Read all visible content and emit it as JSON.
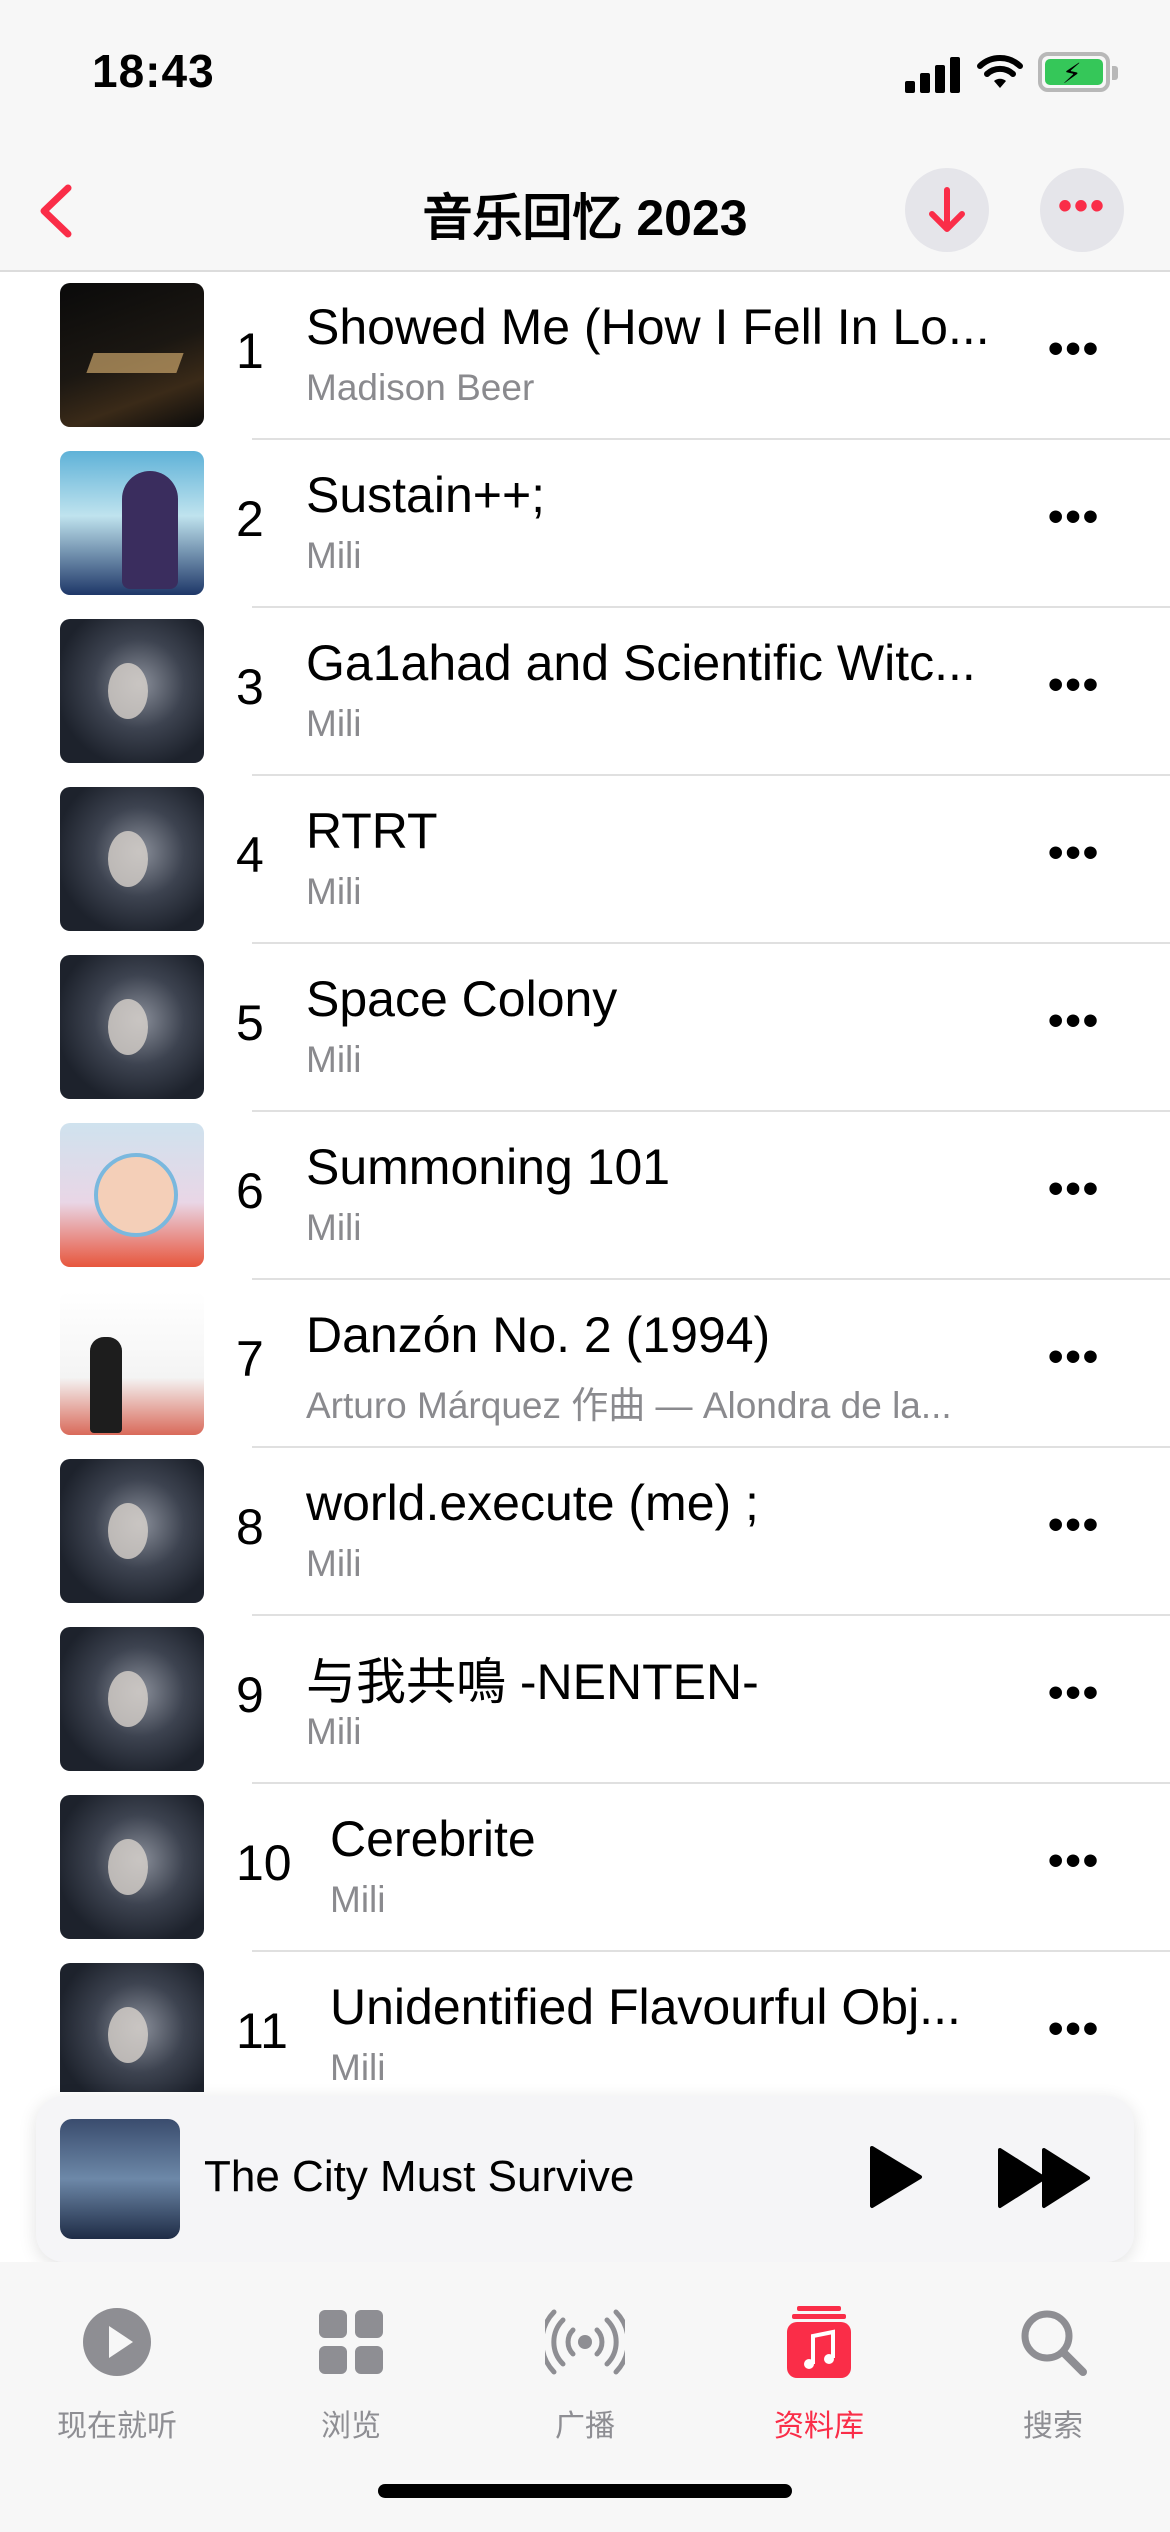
{
  "status_bar": {
    "time": "18:43"
  },
  "nav": {
    "title": "音乐回忆 2023",
    "back_icon": "chevron-left-icon",
    "download_icon": "arrow-down-icon",
    "more_icon": "ellipsis-icon"
  },
  "colors": {
    "accent": "#fa2d48",
    "secondary_text": "#8a8a8e"
  },
  "tracks": [
    {
      "number": "1",
      "title": "Showed Me (How I Fell In Lo...",
      "artist": "Madison Beer",
      "art": "a-dark"
    },
    {
      "number": "2",
      "title": "Sustain++;",
      "artist": "Mili",
      "art": "a-blue"
    },
    {
      "number": "3",
      "title": "Ga1ahad and Scientific Witc...",
      "artist": "Mili",
      "art": "a-mili"
    },
    {
      "number": "4",
      "title": "RTRT",
      "artist": "Mili",
      "art": "a-mili"
    },
    {
      "number": "5",
      "title": "Space Colony",
      "artist": "Mili",
      "art": "a-mili"
    },
    {
      "number": "6",
      "title": "Summoning 101",
      "artist": "Mili",
      "art": "a-mother"
    },
    {
      "number": "7",
      "title": "Danzón No. 2 (1994)",
      "artist": "Arturo Márquez 作曲 — Alondra de la...",
      "art": "a-danzon"
    },
    {
      "number": "8",
      "title": "world.execute (me) ;",
      "artist": "Mili",
      "art": "a-mili"
    },
    {
      "number": "9",
      "title": "与我共鳴 -NENTEN-",
      "artist": "Mili",
      "art": "a-mili"
    },
    {
      "number": "10",
      "title": "Cerebrite",
      "artist": "Mili",
      "art": "a-mili"
    },
    {
      "number": "11",
      "title": "Unidentified Flavourful Obj...",
      "artist": "Mili",
      "art": "a-mili"
    }
  ],
  "row_more": "•••",
  "mini_player": {
    "title": "The City Must Survive",
    "play_icon": "play-icon",
    "forward_icon": "fast-forward-icon"
  },
  "tabs": [
    {
      "label": "现在就听",
      "icon": "play-circle-icon"
    },
    {
      "label": "浏览",
      "icon": "grid-icon"
    },
    {
      "label": "广播",
      "icon": "radio-waves-icon"
    },
    {
      "label": "资料库",
      "icon": "music-library-icon",
      "active": true
    },
    {
      "label": "搜索",
      "icon": "search-icon"
    }
  ]
}
